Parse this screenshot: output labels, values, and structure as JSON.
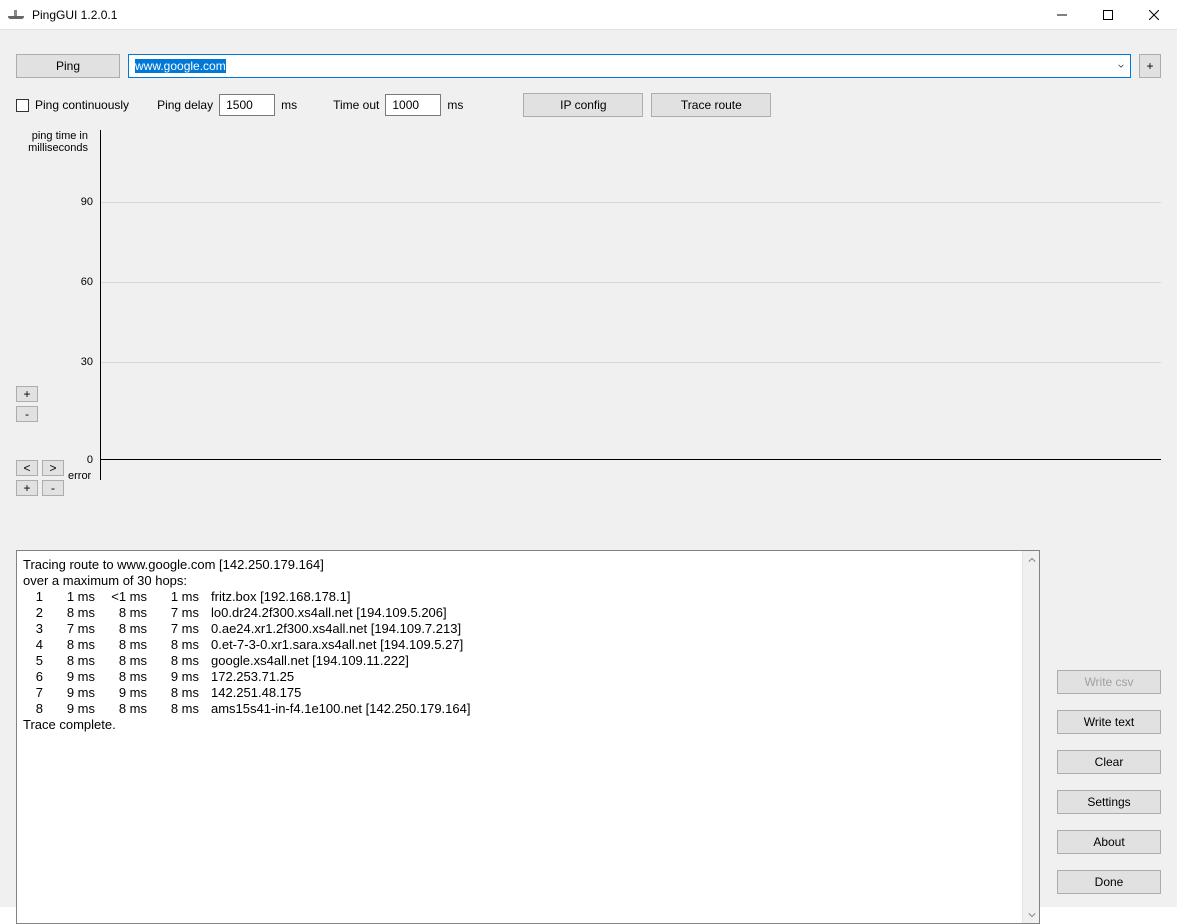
{
  "window": {
    "title": "PingGUI 1.2.0.1"
  },
  "toolbar": {
    "ping_label": "Ping",
    "host_value": "www.google.com",
    "add_host_label": "+"
  },
  "options": {
    "ping_continuously_label": "Ping continuously",
    "ping_continuously_checked": false,
    "ping_delay_label": "Ping delay",
    "ping_delay_value": "1500",
    "ping_delay_unit": "ms",
    "timeout_label": "Time out",
    "timeout_value": "1000",
    "timeout_unit": "ms",
    "ipconfig_label": "IP config",
    "traceroute_label": "Trace route"
  },
  "chart": {
    "ylabel_line1": "ping time in",
    "ylabel_line2": "milliseconds",
    "ticks": [
      "90",
      "60",
      "30",
      "0"
    ],
    "error_label": "error",
    "zoom_in": "+",
    "zoom_out": "-",
    "nav_prev": "<",
    "nav_next": ">",
    "nav_in": "+",
    "nav_out": "-"
  },
  "chart_data": {
    "type": "line",
    "x": [],
    "values": [],
    "title": "ping time in milliseconds",
    "xlabel": "",
    "ylabel": "ping time in milliseconds",
    "ylim": [
      0,
      100
    ],
    "yticks": [
      0,
      30,
      60,
      90
    ]
  },
  "trace": {
    "header1": "Tracing route to www.google.com [142.250.179.164]",
    "header2": "over a maximum of 30 hops:",
    "hops": [
      {
        "n": "1",
        "t1": "1 ms",
        "t2": "<1 ms",
        "t3": "1 ms",
        "host": "fritz.box [192.168.178.1]"
      },
      {
        "n": "2",
        "t1": "8 ms",
        "t2": "8 ms",
        "t3": "7 ms",
        "host": "lo0.dr24.2f300.xs4all.net [194.109.5.206]"
      },
      {
        "n": "3",
        "t1": "7 ms",
        "t2": "8 ms",
        "t3": "7 ms",
        "host": "0.ae24.xr1.2f300.xs4all.net [194.109.7.213]"
      },
      {
        "n": "4",
        "t1": "8 ms",
        "t2": "8 ms",
        "t3": "8 ms",
        "host": "0.et-7-3-0.xr1.sara.xs4all.net [194.109.5.27]"
      },
      {
        "n": "5",
        "t1": "8 ms",
        "t2": "8 ms",
        "t3": "8 ms",
        "host": "google.xs4all.net [194.109.11.222]"
      },
      {
        "n": "6",
        "t1": "9 ms",
        "t2": "8 ms",
        "t3": "9 ms",
        "host": "172.253.71.25"
      },
      {
        "n": "7",
        "t1": "9 ms",
        "t2": "9 ms",
        "t3": "8 ms",
        "host": "142.251.48.175"
      },
      {
        "n": "8",
        "t1": "9 ms",
        "t2": "8 ms",
        "t3": "8 ms",
        "host": "ams15s41-in-f4.1e100.net [142.250.179.164]"
      }
    ],
    "footer": "Trace complete."
  },
  "side": {
    "write_csv": "Write csv",
    "write_text": "Write text",
    "clear": "Clear",
    "settings": "Settings",
    "about": "About",
    "done": "Done"
  }
}
